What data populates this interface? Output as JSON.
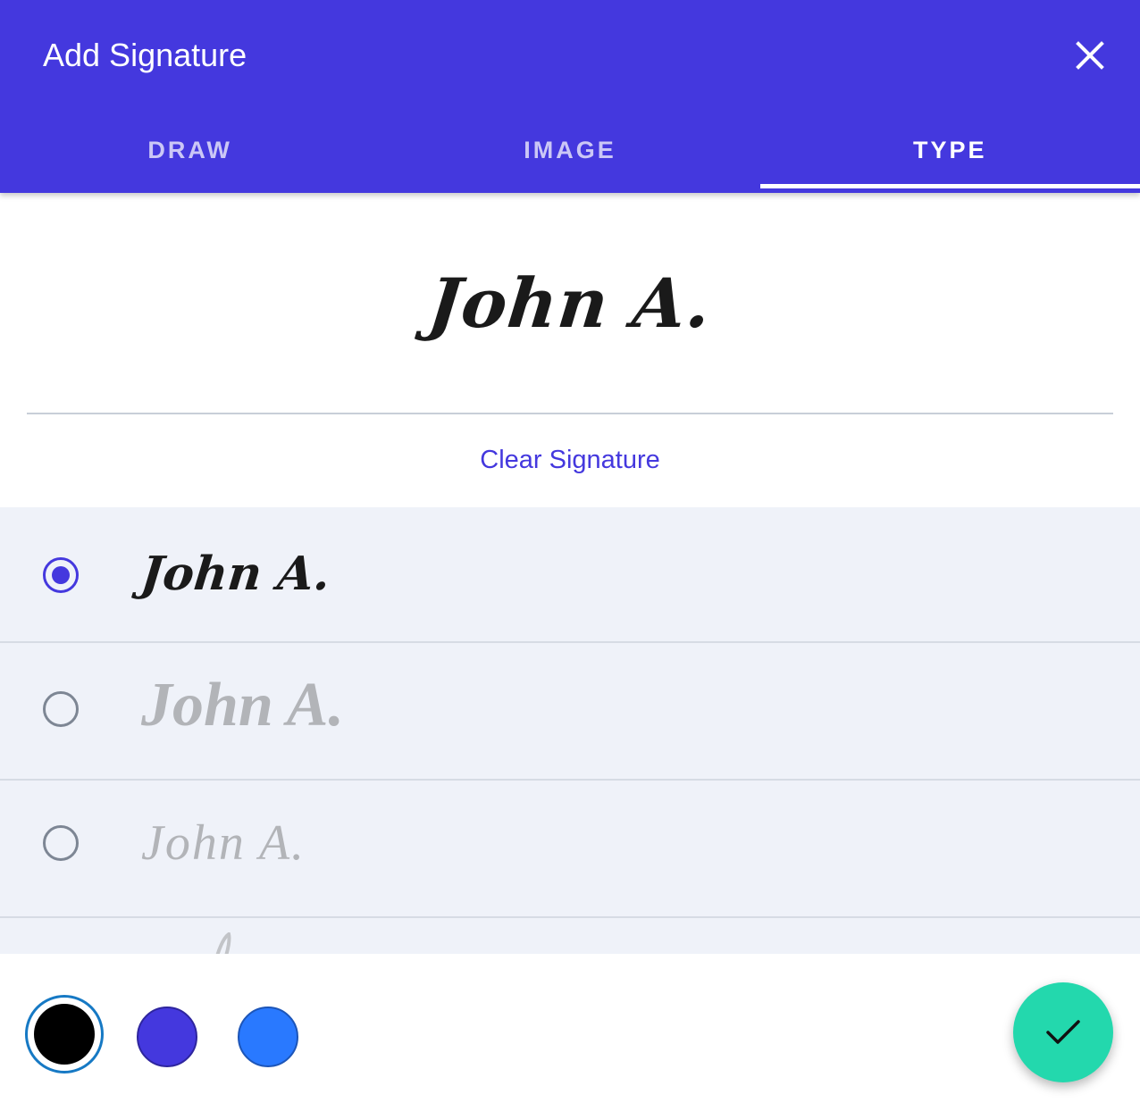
{
  "dialog": {
    "title": "Add Signature",
    "close_icon": "close-icon"
  },
  "tabs": [
    {
      "label": "DRAW",
      "active": false
    },
    {
      "label": "IMAGE",
      "active": false
    },
    {
      "label": "TYPE",
      "active": true
    }
  ],
  "preview": {
    "signature_text": "John A."
  },
  "clear_label": "Clear Signature",
  "font_options": [
    {
      "text": "John A.",
      "selected": true
    },
    {
      "text": "John A.",
      "selected": false
    },
    {
      "text": "John A.",
      "selected": false
    }
  ],
  "colors": {
    "header": "#4438de",
    "accent": "#4438de",
    "confirm": "#23d8ad",
    "swatches": [
      {
        "name": "black",
        "value": "#000000",
        "selected": true
      },
      {
        "name": "purple",
        "value": "#4438de",
        "selected": false
      },
      {
        "name": "blue",
        "value": "#2979ff",
        "selected": false
      }
    ]
  },
  "confirm_icon": "check-icon"
}
